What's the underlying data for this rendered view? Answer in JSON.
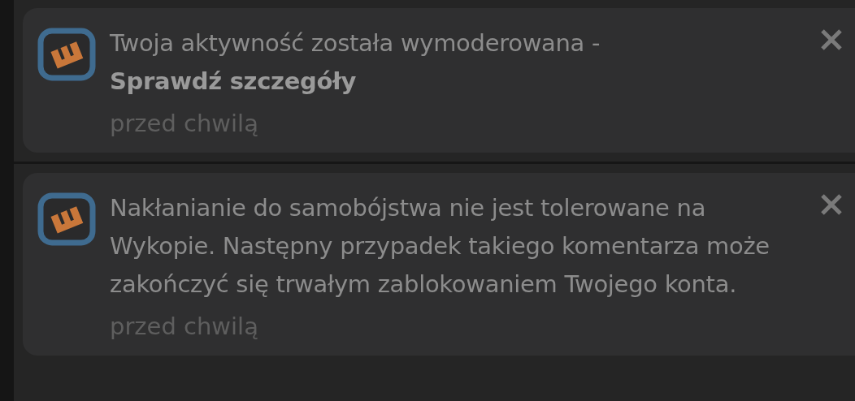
{
  "notifications": [
    {
      "text": "Twoja aktywność została wymoderowana -",
      "link": "Sprawdź szczegóły",
      "time": "przed chwilą"
    },
    {
      "text": "Nakłanianie do samobójstwa nie jest tolerowane na Wykopie. Następny przypadek takiego komentarza może zakończyć się trwałym zablokowaniem Twojego konta.",
      "time": "przed chwilą"
    }
  ]
}
